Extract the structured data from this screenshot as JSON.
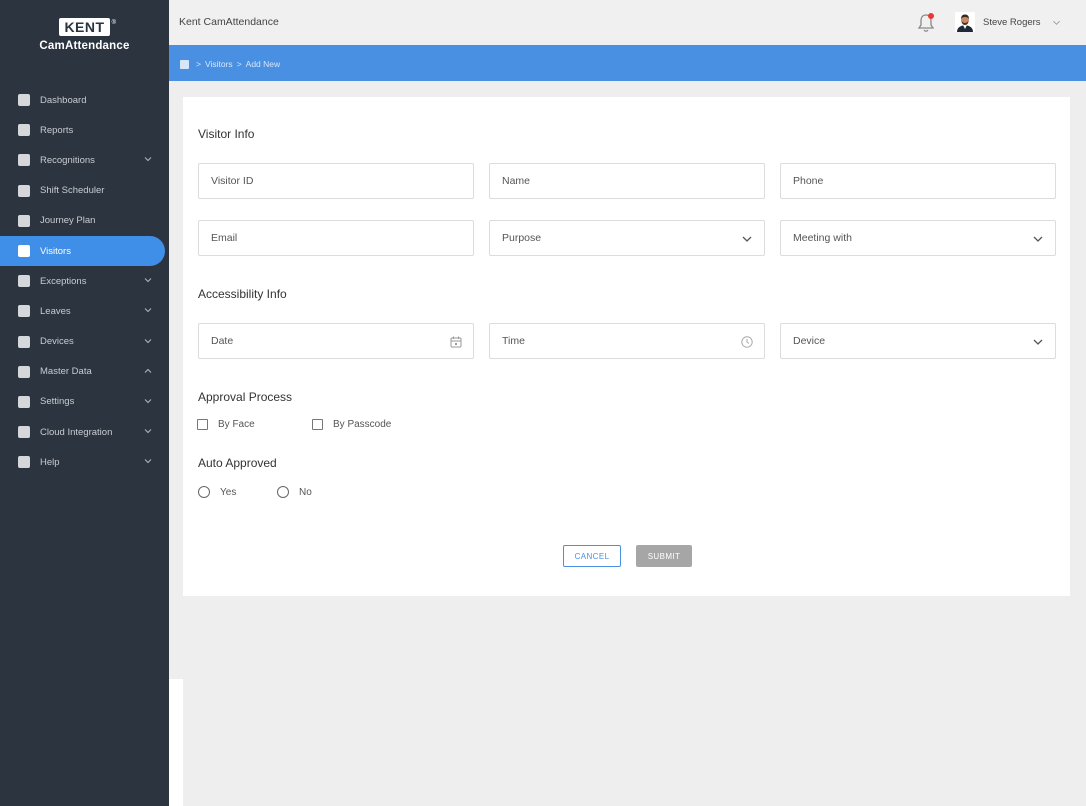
{
  "brand": {
    "logo_text": "KENT",
    "logo_mark": "®",
    "subtitle": "CamAttendance"
  },
  "topbar": {
    "app_title": "Kent CamAttendance",
    "user_name": "Steve Rogers",
    "notification_icon": "bell-icon"
  },
  "breadcrumb": {
    "items": [
      "Visitors",
      "Add New"
    ],
    "separator": ">"
  },
  "sidebar": {
    "items": [
      {
        "label": "Dashboard",
        "chevron": ""
      },
      {
        "label": "Reports",
        "chevron": ""
      },
      {
        "label": "Recognitions",
        "chevron": "down"
      },
      {
        "label": "Shift Scheduler",
        "chevron": ""
      },
      {
        "label": "Journey Plan",
        "chevron": ""
      },
      {
        "label": "Visitors",
        "chevron": "",
        "active": true
      },
      {
        "label": "Exceptions",
        "chevron": "down"
      },
      {
        "label": "Leaves",
        "chevron": "down"
      },
      {
        "label": "Devices",
        "chevron": "down"
      },
      {
        "label": "Master Data",
        "chevron": "up"
      },
      {
        "label": "Settings",
        "chevron": "down"
      },
      {
        "label": "Cloud Integration",
        "chevron": "down"
      },
      {
        "label": "Help",
        "chevron": "down"
      }
    ]
  },
  "form": {
    "visitor_info": {
      "title": "Visitor Info",
      "visitor_id": "Visitor ID",
      "name": "Name",
      "phone": "Phone",
      "email": "Email",
      "purpose": "Purpose",
      "meeting_with": "Meeting with"
    },
    "accessibility_info": {
      "title": "Accessibility Info",
      "date": "Date",
      "time": "Time",
      "device": "Device"
    },
    "approval_process": {
      "title": "Approval Process",
      "by_face": "By Face",
      "by_passcode": "By Passcode"
    },
    "auto_approved": {
      "title": "Auto Approved",
      "yes": "Yes",
      "no": "No"
    },
    "buttons": {
      "cancel": "CANCEL",
      "submit": "SUBMIT"
    }
  },
  "colors": {
    "sidebar": "#2c3440",
    "accent": "#4a90e2",
    "active_item": "#3f8ee8",
    "submit_disabled": "#a6a6a6"
  }
}
